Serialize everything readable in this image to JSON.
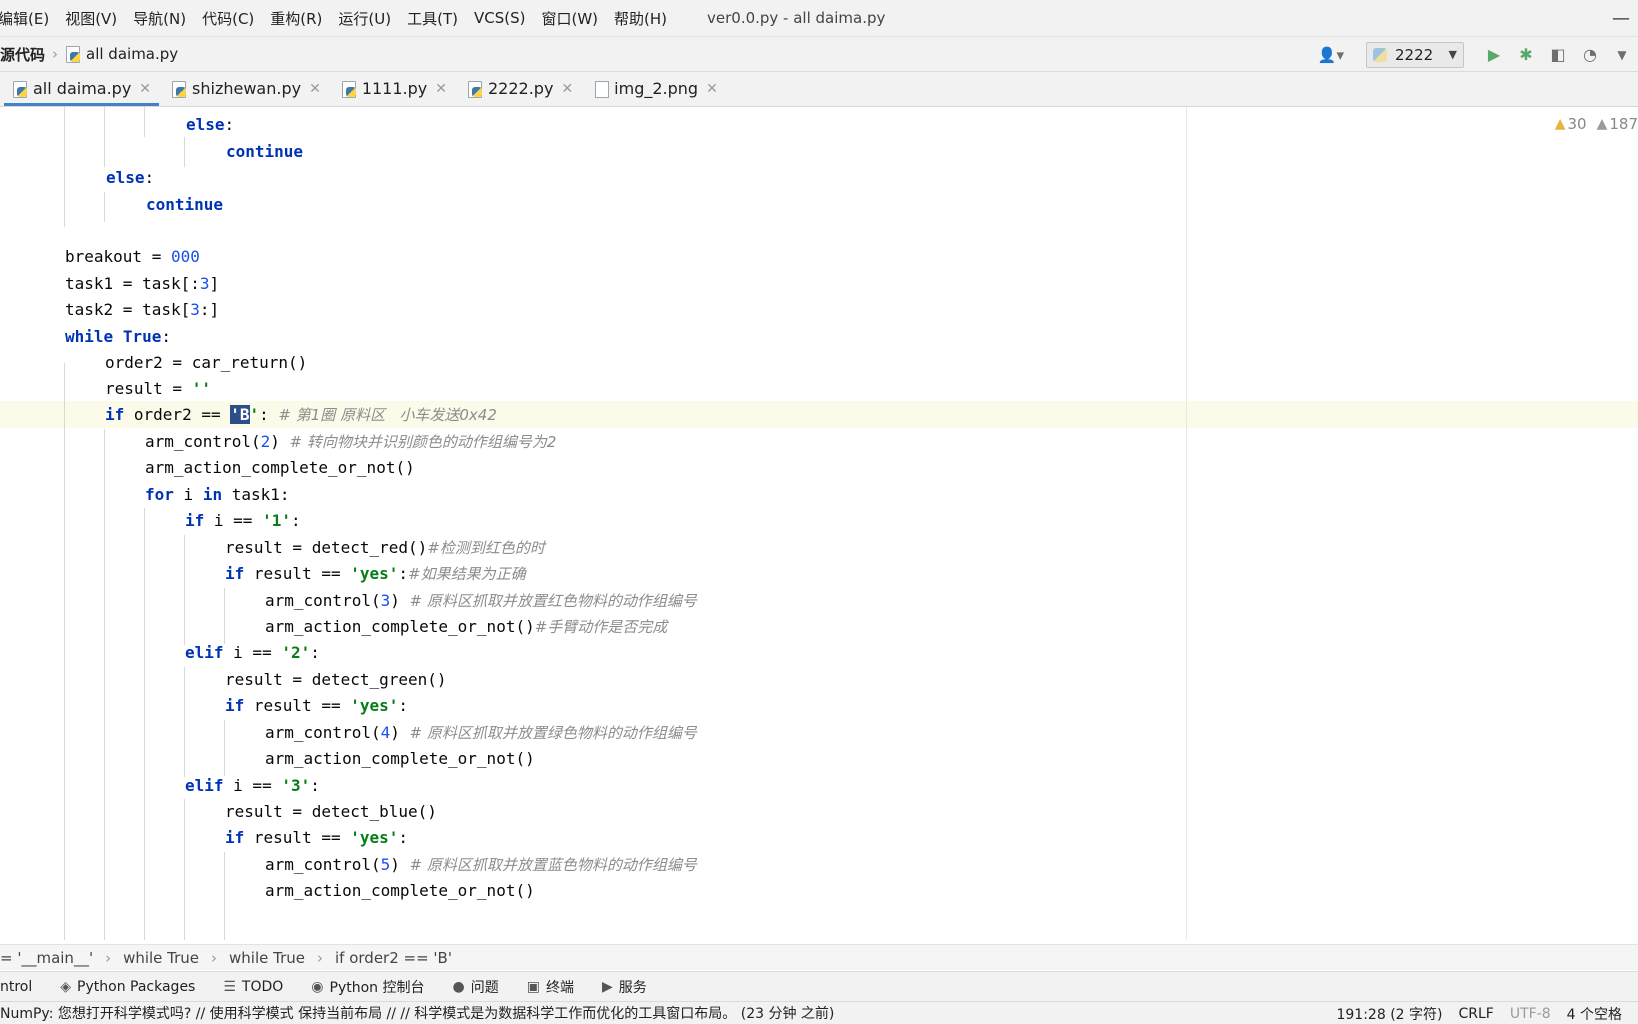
{
  "menu": {
    "items": [
      "编辑(E)",
      "视图(V)",
      "导航(N)",
      "代码(C)",
      "重构(R)",
      "运行(U)",
      "工具(T)",
      "VCS(S)",
      "窗口(W)",
      "帮助(H)"
    ],
    "window_title": "ver0.0.py - all daima.py",
    "minimize_glyph": "—"
  },
  "navbar": {
    "root": "源代码",
    "file": "all daima.py",
    "run_config": "2222"
  },
  "tabs": [
    {
      "label": "all daima.py",
      "active": true
    },
    {
      "label": "shizhewan.py",
      "active": false
    },
    {
      "label": "1111.py",
      "active": false
    },
    {
      "label": "2222.py",
      "active": false
    },
    {
      "label": "img_2.png",
      "active": false
    }
  ],
  "inspection": {
    "warnings": "30",
    "weak_warnings": "187"
  },
  "code": {
    "l_else1": "else",
    "l_continue1": "continue",
    "l_else2": "else",
    "l_continue2": "continue",
    "breakout_a": "breakout = ",
    "breakout_b": "000",
    "task1_a": "task1 = task[:",
    "task1_b": "3",
    "task1_c": "]",
    "task2_a": "task2 = task[",
    "task2_b": "3",
    "task2_c": ":]",
    "while_kw": "while",
    "while_true": "True",
    "order2": "order2 = car_return()",
    "result_a": "result = ",
    "result_b": "''",
    "if_kw": "if",
    "if_a": " order2 == ",
    "if_str_open": "'",
    "if_sel": "B",
    "if_str_close": "'",
    "if_b": ": ",
    "if_cmt": "# 第1圈 原料区   小车发送0x42",
    "arm2_a": "arm_control(",
    "arm2_b": "2",
    "arm2_c": ") ",
    "arm2_cmt": "# 转向物块并识别颜色的动作组编号为2",
    "arm_complete": "arm_action_complete_or_not()",
    "for_kw": "for",
    "for_a": " i ",
    "in_kw": "in",
    "for_b": " task1:",
    "if1_a": " i == ",
    "s1": "'1'",
    "red_a": "result = detect_red()",
    "red_cmt": "#检测到红色的时",
    "yes_a": " result == ",
    "yes_s": "'yes'",
    "yes_cmt": "#如果结果为正确",
    "arm3_a": "arm_control(",
    "arm3_b": "3",
    "arm3_c": ") ",
    "arm3_cmt": "# 原料区抓取并放置红色物料的动作组编号",
    "arm_complete_cmt": "#手臂动作是否完成",
    "elif_kw": "elif",
    "s2": "'2'",
    "green": "result = detect_green()",
    "arm4_b": "4",
    "arm4_cmt": "# 原料区抓取并放置绿色物料的动作组编号",
    "s3": "'3'",
    "blue": "result = detect_blue()",
    "arm5_b": "5",
    "arm5_cmt": "# 原料区抓取并放置蓝色物料的动作组编号",
    "colon": ":"
  },
  "breadcrumb": [
    "= '__main__'",
    "while True",
    "while True",
    "if order2 == 'B'"
  ],
  "toolwindows": [
    "ntrol",
    "Python Packages",
    "TODO",
    "Python 控制台",
    "问题",
    "终端",
    "服务"
  ],
  "status": {
    "message": "NumPy: 您想打开科学模式吗?  // 使用科学模式  保持当前布局 // // 科学模式是为数据科学工作而优化的工具窗口布局。 (23 分钟 之前)",
    "position": "191:28 (2 字符)",
    "line_sep": "CRLF",
    "encoding": "UTF-8",
    "indent": "4 个空格"
  },
  "colors": {
    "keyword": "#0033b3",
    "number": "#1750eb",
    "string": "#067d17",
    "comment": "#8c8c8c",
    "accent": "#4083c9"
  }
}
